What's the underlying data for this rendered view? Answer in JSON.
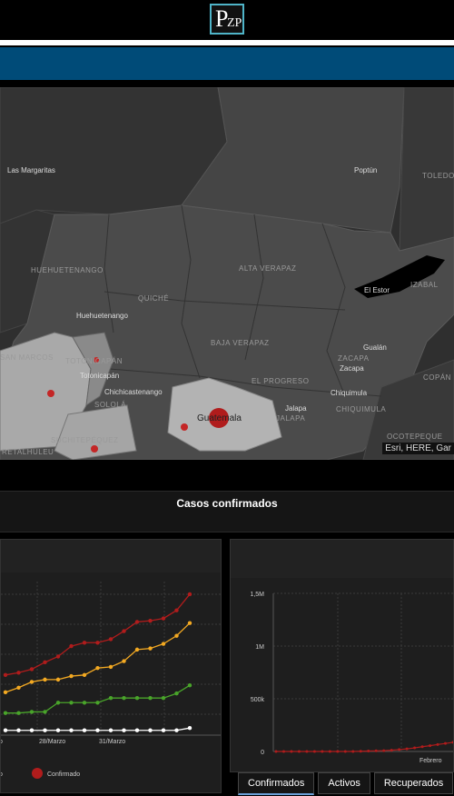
{
  "header": {
    "logo_big": "P",
    "logo_small": "ZP"
  },
  "map": {
    "labels": {
      "las_margaritas": "Las Margaritas",
      "poptun": "Poptún",
      "toledo": "TOLEDO",
      "huehuetenango_dept": "HUEHUETENANGO",
      "quiche": "QUICHÉ",
      "alta_verapaz": "ALTA VERAPAZ",
      "el_estor": "El Estor",
      "izabal": "IZABAL",
      "huehuetenango": "Huehuetenango",
      "baja_verapaz": "BAJA VERAPAZ",
      "gualan": "Gualán",
      "zacapa_dept": "ZACAPA",
      "zacapa": "Zacapa",
      "san_marcos": "SAN MARCOS",
      "totonicapan_dept": "TOTONICAPÁN",
      "totonicapan": "Totonicapán",
      "chichicastenango": "Chichicastenango",
      "solola": "SOLOLÁ",
      "el_progreso": "EL PROGRESO",
      "chiquimula": "Chiquimula",
      "chiquimula_dept": "CHIQUIMULA",
      "copan": "COPÁN",
      "guatemala": "Guatemala",
      "jalapa": "Jalapa",
      "jalapa_dept": "JALAPA",
      "suchitepequez": "SUCHITEPÉQUEZ",
      "retalhuleu": "RETALHULEU",
      "ocotepeque": "OCOTEPEQUE"
    },
    "attribution": "Esri, HERE, Gar"
  },
  "panel": {
    "title": "Casos confirmados"
  },
  "tabs": [
    "Confirmados",
    "Activos",
    "Recuperados"
  ],
  "chart_data": [
    {
      "type": "line",
      "x_tick_labels": [
        "o",
        "28/Marzo",
        "31/Marzo"
      ],
      "legend": [
        "o",
        "Confirmado"
      ],
      "series": [
        {
          "name": "Confirmado",
          "color": "#b01c1c",
          "values": [
            49,
            51,
            54,
            60,
            65,
            74,
            77,
            77,
            80,
            87,
            95,
            96,
            98,
            105,
            119
          ]
        },
        {
          "color": "#f3a922",
          "values": [
            34,
            38,
            43,
            45,
            45,
            48,
            49,
            55,
            56,
            61,
            71,
            72,
            76,
            83,
            94
          ]
        },
        {
          "color": "#49a42a",
          "values": [
            16,
            16,
            17,
            17,
            25,
            25,
            25,
            25,
            29,
            29,
            29,
            29,
            29,
            33,
            40
          ]
        },
        {
          "color": "#ffffff",
          "values": [
            1,
            1,
            1,
            1,
            1,
            1,
            1,
            1,
            1,
            1,
            1,
            1,
            1,
            1,
            3
          ]
        }
      ]
    },
    {
      "type": "line",
      "y_tick_labels": [
        "1,5M",
        "1M",
        "500k",
        "0"
      ],
      "ylim": [
        0,
        1500000
      ],
      "x_tick_labels": [
        "Febrero"
      ],
      "series": [
        {
          "color": "#b01c1c",
          "values": [
            0,
            0,
            0,
            0,
            0,
            0,
            0,
            0,
            0,
            0,
            0,
            2000,
            4000,
            6000,
            8000,
            12000,
            18000,
            25000,
            34000,
            45000,
            55000,
            66000,
            76000,
            87000
          ]
        }
      ]
    }
  ]
}
